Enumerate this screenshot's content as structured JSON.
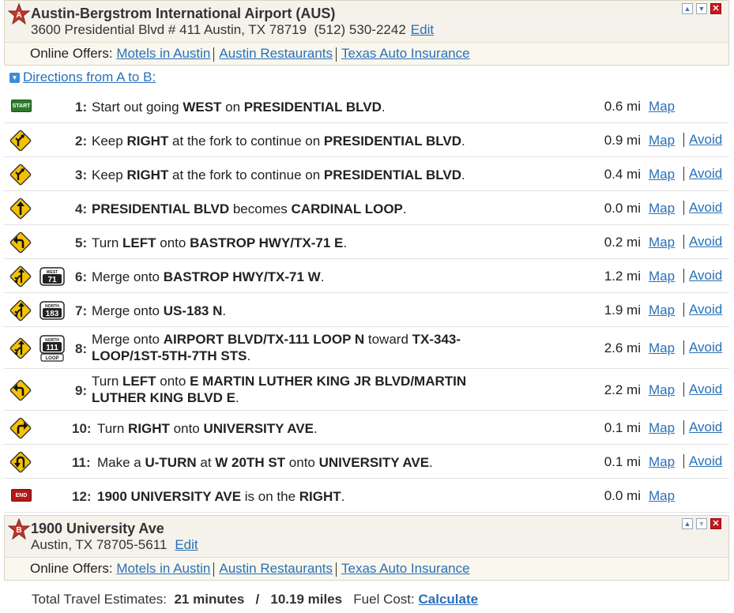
{
  "origin": {
    "marker": "A",
    "name": "Austin-Bergstrom International Airport (AUS)",
    "address": "3600 Presidential Blvd # 411 Austin, TX 78719",
    "phone": "(512) 530-2242",
    "edit_label": "Edit",
    "offers_label": "Online Offers:",
    "offers": [
      "Motels in Austin",
      "Austin Restaurants",
      "Texas Auto Insurance"
    ]
  },
  "directions_heading": "Directions from A to B:",
  "steps": [
    {
      "num": "1:",
      "parts": [
        "Start out going ",
        "WEST",
        " on ",
        "PRESIDENTIAL BLVD",
        "."
      ],
      "dist": "0.6 mi",
      "icon": "start-badge",
      "badge": "START",
      "shield": null
    },
    {
      "num": "2:",
      "parts": [
        "Keep ",
        "RIGHT",
        " at the fork to continue on ",
        "PRESIDENTIAL BLVD",
        "."
      ],
      "dist": "0.9 mi",
      "icon": "keep-right-icon",
      "shield": null
    },
    {
      "num": "3:",
      "parts": [
        "Keep ",
        "RIGHT",
        " at the fork to continue on ",
        "PRESIDENTIAL BLVD",
        "."
      ],
      "dist": "0.4 mi",
      "icon": "keep-right-icon",
      "shield": null
    },
    {
      "num": "4:",
      "parts": [
        "",
        "PRESIDENTIAL BLVD",
        " becomes ",
        "CARDINAL LOOP",
        "."
      ],
      "dist": "0.0 mi",
      "icon": "straight-icon",
      "shield": null
    },
    {
      "num": "5:",
      "parts": [
        "Turn ",
        "LEFT",
        " onto ",
        "BASTROP HWY/TX-71 E",
        "."
      ],
      "dist": "0.2 mi",
      "icon": "turn-left-icon",
      "shield": null
    },
    {
      "num": "6:",
      "parts": [
        "Merge onto ",
        "BASTROP HWY/TX-71 W",
        "."
      ],
      "dist": "1.2 mi",
      "icon": "merge-icon",
      "shield": {
        "top": "WEST",
        "number": "71"
      }
    },
    {
      "num": "7:",
      "parts": [
        "Merge onto ",
        "US-183 N",
        "."
      ],
      "dist": "1.9 mi",
      "icon": "merge-icon",
      "shield": {
        "top": "NORTH",
        "number": "183"
      }
    },
    {
      "num": "8:",
      "parts": [
        "Merge onto ",
        "AIRPORT BLVD/TX-111 LOOP N",
        " toward ",
        "TX-343-LOOP/1ST-5TH-7TH STS",
        "."
      ],
      "dist": "2.6 mi",
      "icon": "merge-icon",
      "shield": {
        "top": "NORTH",
        "number": "111",
        "bottom": "LOOP"
      }
    },
    {
      "num": "9:",
      "parts": [
        "Turn ",
        "LEFT",
        " onto ",
        "E MARTIN LUTHER KING JR BLVD/MARTIN LUTHER KING BLVD E",
        "."
      ],
      "dist": "2.2 mi",
      "icon": "turn-left-icon",
      "shield": null
    },
    {
      "num": "10:",
      "parts": [
        "Turn ",
        "RIGHT",
        " onto ",
        "UNIVERSITY AVE",
        "."
      ],
      "dist": "0.1 mi",
      "icon": "turn-right-icon",
      "shield": null
    },
    {
      "num": "11:",
      "parts": [
        "Make a ",
        "U-TURN",
        " at ",
        "W 20TH ST",
        " onto ",
        "UNIVERSITY AVE",
        "."
      ],
      "dist": "0.1 mi",
      "icon": "u-turn-icon",
      "shield": null
    },
    {
      "num": "12:",
      "parts": [
        "",
        "1900 UNIVERSITY AVE",
        " is on the ",
        "RIGHT",
        "."
      ],
      "dist": "0.0 mi",
      "icon": "end-badge",
      "badge": "END",
      "shield": null
    }
  ],
  "map_label": "Map",
  "avoid_label": "Avoid",
  "destination": {
    "marker": "B",
    "name": "1900 University Ave",
    "address": "Austin, TX 78705-5611",
    "edit_label": "Edit",
    "offers_label": "Online Offers:",
    "offers": [
      "Motels in Austin",
      "Austin Restaurants",
      "Texas Auto Insurance"
    ]
  },
  "totals": {
    "label": "Total Travel Estimates:",
    "time": "21 minutes",
    "slash": "/",
    "distance": "10.19 miles",
    "fuel_label": "Fuel Cost:",
    "fuel_link": "Calculate"
  },
  "colors": {
    "link": "#2a70b8",
    "sign_yellow": "#f6c200",
    "start_green": "#2f7a2a",
    "end_red": "#b11a1a"
  }
}
